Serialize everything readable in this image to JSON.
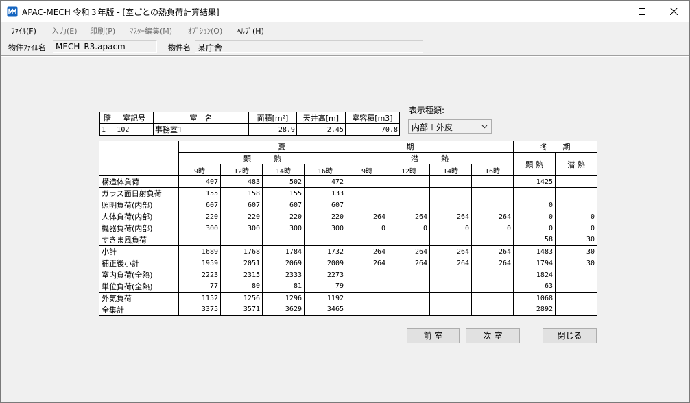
{
  "window": {
    "title": "APAC-MECH 令和３年版 - [室ごとの熱負荷計算結果]",
    "minimize": "—",
    "maximize": "☐",
    "close": "✕"
  },
  "menu": {
    "items": [
      {
        "label": "ﾌｧｲﾙ(F)",
        "enabled": true
      },
      {
        "label": "入力(E)",
        "enabled": false
      },
      {
        "label": "印刷(P)",
        "enabled": false
      },
      {
        "label": "ﾏｽﾀｰ編集(M)",
        "enabled": false
      },
      {
        "label": "ｵﾌﾟｼｮﾝ(O)",
        "enabled": false
      },
      {
        "label": "ﾍﾙﾌﾟ(H)",
        "enabled": true
      }
    ]
  },
  "info": {
    "file_label": "物件ﾌｧｲﾙ名",
    "file_value": "MECH_R3.apacm",
    "name_label": "物件名",
    "name_value": "某庁舎"
  },
  "room": {
    "headers": [
      "階",
      "室記号",
      "室　名",
      "面積[m²]",
      "天井高[m]",
      "室容積[m3]"
    ],
    "values": [
      "1",
      "102",
      "事務室1",
      "28.9",
      "2.45",
      "70.8"
    ]
  },
  "display_type": {
    "label": "表示種類:",
    "value": "内部＋外皮"
  },
  "load_table": {
    "h_summer": "夏　　　　　　　　　　　　　　　　期",
    "h_winter": "冬　　期",
    "h_sensible": "顕　　　熱",
    "h_latent": "潜　　　熱",
    "h_w_sensible": "顕 熱",
    "h_w_latent": "潜 熱",
    "hours": [
      "9時",
      "12時",
      "14時",
      "16時",
      "9時",
      "12時",
      "14時",
      "16時"
    ],
    "groups": [
      {
        "rows": [
          {
            "label": "構造体負荷",
            "s": [
              "407",
              "483",
              "502",
              "472"
            ],
            "l": [
              "",
              "",
              "",
              ""
            ],
            "ws": "1425",
            "wl": ""
          }
        ]
      },
      {
        "rows": [
          {
            "label": "ガラス面日射負荷",
            "s": [
              "155",
              "158",
              "155",
              "133"
            ],
            "l": [
              "",
              "",
              "",
              ""
            ],
            "ws": "",
            "wl": ""
          }
        ]
      },
      {
        "rows": [
          {
            "label": "照明負荷(内部)",
            "s": [
              "607",
              "607",
              "607",
              "607"
            ],
            "l": [
              "",
              "",
              "",
              ""
            ],
            "ws": "0",
            "wl": ""
          },
          {
            "label": "人体負荷(内部)",
            "s": [
              "220",
              "220",
              "220",
              "220"
            ],
            "l": [
              "264",
              "264",
              "264",
              "264"
            ],
            "ws": "0",
            "wl": "0"
          },
          {
            "label": "機器負荷(内部)",
            "s": [
              "300",
              "300",
              "300",
              "300"
            ],
            "l": [
              "0",
              "0",
              "0",
              "0"
            ],
            "ws": "0",
            "wl": "0"
          },
          {
            "label": "すきま風負荷",
            "s": [
              "",
              "",
              "",
              ""
            ],
            "l": [
              "",
              "",
              "",
              ""
            ],
            "ws": "58",
            "wl": "30"
          }
        ]
      },
      {
        "rows": [
          {
            "label": "小計",
            "s": [
              "1689",
              "1768",
              "1784",
              "1732"
            ],
            "l": [
              "264",
              "264",
              "264",
              "264"
            ],
            "ws": "1483",
            "wl": "30"
          },
          {
            "label": "補正後小計",
            "s": [
              "1959",
              "2051",
              "2069",
              "2009"
            ],
            "l": [
              "264",
              "264",
              "264",
              "264"
            ],
            "ws": "1794",
            "wl": "30"
          },
          {
            "label": "室内負荷(全熱)",
            "s": [
              "2223",
              "2315",
              "2333",
              "2273"
            ],
            "l": [
              "",
              "",
              "",
              ""
            ],
            "ws": "1824",
            "wl": ""
          },
          {
            "label": "単位負荷(全熱)",
            "s": [
              "77",
              "80",
              "81",
              "79"
            ],
            "l": [
              "",
              "",
              "",
              ""
            ],
            "ws": "63",
            "wl": ""
          }
        ]
      },
      {
        "rows": [
          {
            "label": "外気負荷",
            "s": [
              "1152",
              "1256",
              "1296",
              "1192"
            ],
            "l": [
              "",
              "",
              "",
              ""
            ],
            "ws": "1068",
            "wl": ""
          },
          {
            "label": "全集計",
            "s": [
              "3375",
              "3571",
              "3629",
              "3465"
            ],
            "l": [
              "",
              "",
              "",
              ""
            ],
            "ws": "2892",
            "wl": ""
          }
        ]
      }
    ]
  },
  "buttons": {
    "prev": "前 室",
    "next": "次 室",
    "close": "閉じる"
  }
}
